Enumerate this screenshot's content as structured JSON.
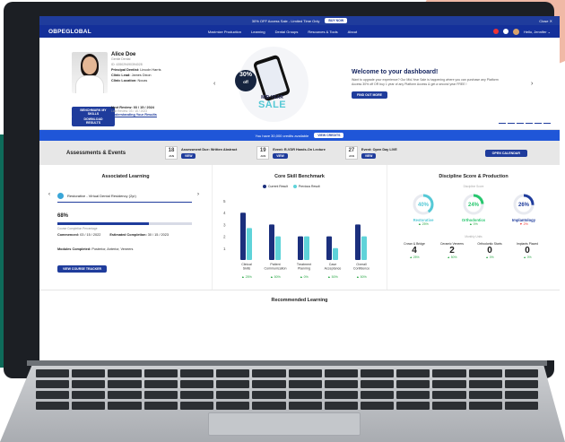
{
  "promo": {
    "text": "30% OFF Access Sale - Limited Time Only",
    "button": "BUY NOW",
    "close": "Close ✕"
  },
  "nav": {
    "logo": "OBPEGLOBAL",
    "links": [
      "Maximize Production",
      "Learning",
      "Dental Groups",
      "Resources & Tools",
      "About"
    ],
    "greeting": "Hello, Jennifer ⌄"
  },
  "profile": {
    "name": "Alice Doe",
    "title": "Gentle Dental",
    "id": "ID: 435029490394028",
    "principal_label": "Principal Dentist:",
    "principal": "Lincoln Harris",
    "clinic_lead_label": "Clinic Lead:",
    "clinic_lead": "James Dixon",
    "location_label": "Clinic Location:",
    "location": "Nocas",
    "benchmark_button": "BENCHMARK MY SKILLS",
    "download_button": "DOWNLOAD RESULTS",
    "next_review": "Next Review: 03 / 15 / 2024",
    "last_review": "Last Review: 03 / 15 / 2023",
    "understanding_link": "Understanding Your Results"
  },
  "banner": {
    "percent": "30%",
    "off": "off",
    "midyear": "MID-YEAR",
    "sale": "SALE",
    "heading": "Welcome to your dashboard!",
    "body": "Want to upgrade your experience? Our Mid-Year Sale is happening where you can purchase any Platform Access 30% off OR buy 1 year of any Platform Access & get a second year FREE !",
    "find_button": "FIND OUT MORE",
    "prev": "‹",
    "next": "›"
  },
  "credits": {
    "text": "You have 30,000 credits available",
    "button": "VIEW CREDITS"
  },
  "events": {
    "title": "Assessments & Events",
    "items": [
      {
        "day": "18",
        "month": "JAN",
        "label": "Assessment Due: Written Abstract",
        "button": "VIEW"
      },
      {
        "day": "19",
        "month": "JAN",
        "label": "Event: R-VDR Hands-On Lecture",
        "button": "VIEW"
      },
      {
        "day": "27",
        "month": "JAN",
        "label": "Event: Open Day LIVE",
        "button": "VIEW"
      }
    ],
    "calendar_button": "OPEN CALENDAR"
  },
  "learning": {
    "title": "Associated Learning",
    "course": "Restorative - Virtual Dental Residency (2yr)",
    "percent_label": "68%",
    "completion": 0.68,
    "caption": "Course Completion Percentage",
    "commenced_label": "Commenced:",
    "commenced": "03 / 15 / 2022",
    "estimated_label": "Estimated Completion:",
    "estimated": "30 / 15 / 2023",
    "modules_label": "Modules Completed:",
    "modules": "Posterior, Anterior, Veneers",
    "tracker_button": "VIEW COURSE TRACKER"
  },
  "skills": {
    "title": "Core Skill Benchmark",
    "legend": [
      "Current Result",
      "Previous Result"
    ]
  },
  "chart_data": {
    "type": "bar",
    "title": "Core Skill Benchmark",
    "categories": [
      "Clinical Skills",
      "Patient Communication",
      "Treatment Planning",
      "Case Acceptance",
      "Overall Confidence"
    ],
    "series": [
      {
        "name": "Current Result",
        "values": [
          4.0,
          3.0,
          2.0,
          2.0,
          3.0
        ],
        "color": "#1b2f7d"
      },
      {
        "name": "Previous Result",
        "values": [
          2.7,
          2.0,
          2.0,
          1.0,
          2.0
        ],
        "color": "#5fd3d9"
      }
    ],
    "changes": [
      "▲ 25%",
      "▲ 50%",
      "▲ 0%",
      "▲ 50%",
      "▲ 50%"
    ],
    "ylim": [
      0,
      5
    ],
    "yticks": [
      "1",
      "2",
      "3",
      "4",
      "5"
    ],
    "grid": false,
    "legend_position": "top"
  },
  "discipline": {
    "title": "Discipline Score & Production",
    "scores_label": "Discipline Score",
    "dials": [
      {
        "value": "40%",
        "fraction": 0.4,
        "label": "Restorative",
        "change": "▲ 25%",
        "color": "#55c9d6",
        "dir": "up"
      },
      {
        "value": "24%",
        "fraction": 0.24,
        "label": "Orthodontics",
        "change": "▲ 0%",
        "color": "#28c76f",
        "dir": "up"
      },
      {
        "value": "26%",
        "fraction": 0.26,
        "label": "Implantology",
        "change": "▼ 2%",
        "color": "#1f3c9c",
        "dir": "down"
      }
    ],
    "monthly_label": "Monthly Units",
    "stats": [
      {
        "label": "Crown & Bridge",
        "value": "4",
        "change": "▲ 25%"
      },
      {
        "label": "Ceramic Veneers",
        "value": "2",
        "change": "▲ 50%"
      },
      {
        "label": "Orthodontic Starts",
        "value": "0",
        "change": "▲ 0%"
      },
      {
        "label": "Implants Placed",
        "value": "0",
        "change": "▲ 0%"
      }
    ]
  },
  "recommended": {
    "title": "Recommended Learning"
  },
  "colors": {
    "brand": "#1f3c9c",
    "accent": "#55c9d6",
    "credits_bar": "#1f56d8"
  }
}
